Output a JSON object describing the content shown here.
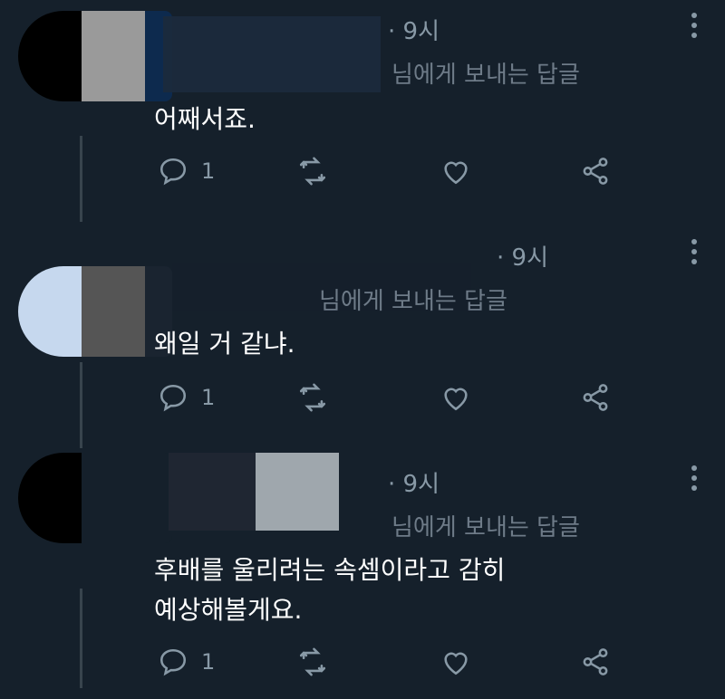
{
  "tweets": [
    {
      "time": "· 9시",
      "reply_to": "님에게 보내는 답글",
      "body": "어째서죠.",
      "reply_count": "1",
      "avatar_colors": [
        "#000000",
        "#9a9a9a",
        "#0d2a4e"
      ]
    },
    {
      "time": "· 9시",
      "reply_to": "님에게 보내는 답글",
      "body": "왜일 거 같냐.",
      "reply_count": "1",
      "avatar_colors": [
        "#c6d8ee",
        "#555555",
        "#1a2430"
      ]
    },
    {
      "time": "· 9시",
      "reply_to": "님에게 보내는 답글",
      "body": "후배를 울리려는 속셈이라고 감히\n예상해볼게요.",
      "reply_count": "1",
      "avatar_colors": [
        "#000000",
        "#a7aeb4",
        "#202733"
      ]
    }
  ],
  "icons": {
    "reply": "reply-icon",
    "retweet": "retweet-icon",
    "like": "like-icon",
    "share": "share-icon",
    "more": "more-icon"
  },
  "colors": {
    "background": "#15202b",
    "text": "#ffffff",
    "muted": "#8899a6",
    "thread": "#38444d"
  }
}
